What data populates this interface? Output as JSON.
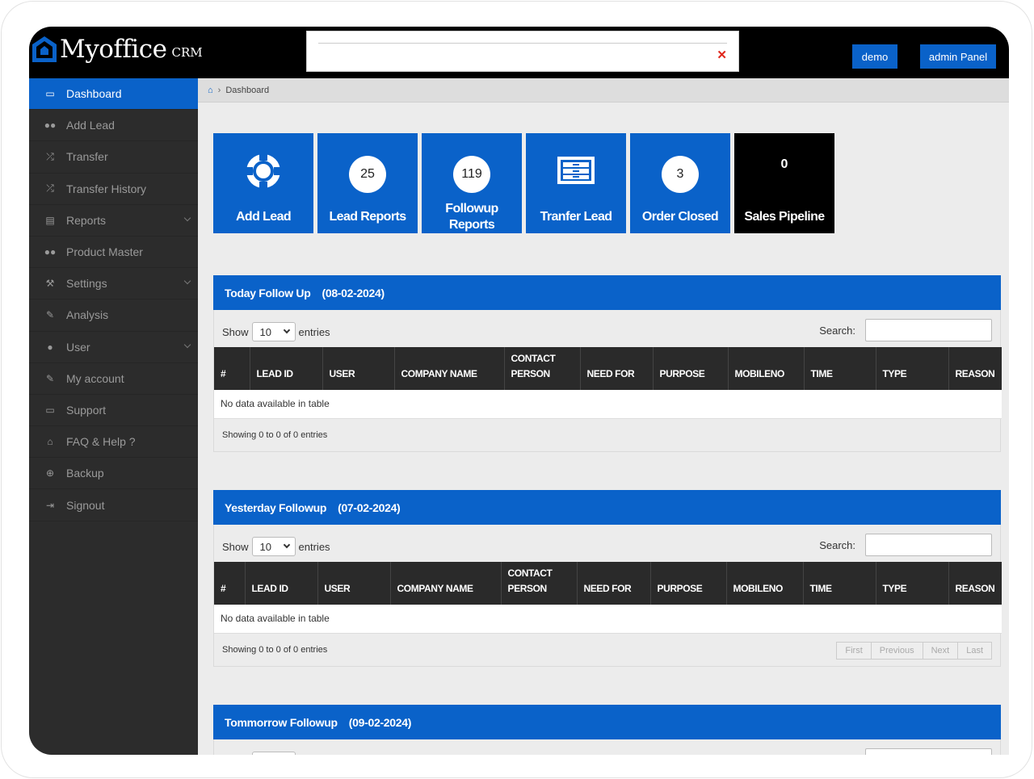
{
  "app": {
    "brand": "Myoffice",
    "brand_suffix": "CRM"
  },
  "search": {
    "clear_icon": "close-icon"
  },
  "top_buttons": {
    "demo": "demo",
    "admin": "admin Panel"
  },
  "sidebar": {
    "items": [
      {
        "label": "Dashboard",
        "icon": "laptop-icon",
        "active": true
      },
      {
        "label": "Add Lead",
        "icon": "users-icon"
      },
      {
        "label": "Transfer",
        "icon": "shuffle-icon"
      },
      {
        "label": "Transfer History",
        "icon": "shuffle-icon"
      },
      {
        "label": "Reports",
        "icon": "book-icon",
        "dropdown": true
      },
      {
        "label": "Product Master",
        "icon": "users-icon"
      },
      {
        "label": "Settings",
        "icon": "wrench-icon",
        "dropdown": true
      },
      {
        "label": "Analysis",
        "icon": "pencil-icon"
      },
      {
        "label": "User",
        "icon": "user-icon",
        "dropdown": true
      },
      {
        "label": "My account",
        "icon": "edit-icon"
      },
      {
        "label": "Support",
        "icon": "laptop-icon"
      },
      {
        "label": "FAQ & Help ?",
        "icon": "home-icon"
      },
      {
        "label": "Backup",
        "icon": "download-icon"
      },
      {
        "label": "Signout",
        "icon": "signout-icon"
      }
    ]
  },
  "breadcrumb": {
    "current": "Dashboard"
  },
  "tiles": [
    {
      "label": "Add Lead",
      "value": null,
      "icon": "lifebuoy-icon"
    },
    {
      "label": "Lead Reports",
      "value": "25"
    },
    {
      "label": "Followup Reports",
      "value": "119"
    },
    {
      "label": "Tranfer Lead",
      "value": null,
      "icon": "cabinet-icon"
    },
    {
      "label": "Order Closed",
      "value": "3"
    },
    {
      "label": "Sales Pipeline",
      "value": "0"
    }
  ],
  "columns": [
    "#",
    "LEAD ID",
    "USER",
    "COMPANY NAME",
    "CONTACT PERSON",
    "NEED FOR",
    "PURPOSE",
    "MOBILENO",
    "TIME",
    "TYPE",
    "REASON"
  ],
  "panels": {
    "today": {
      "title": "Today Follow Up",
      "date": "(08-02-2024)"
    },
    "yesterday": {
      "title": "Yesterday Followup",
      "date": "(07-02-2024)"
    },
    "tomorrow": {
      "title": "Tommorrow Followup",
      "date": "(09-02-2024)"
    }
  },
  "table_ui": {
    "show_label": "Show",
    "entries_value": "10",
    "entries_label": "entries",
    "search_label": "Search:",
    "empty_text": "No data available in table",
    "info_text": "Showing 0 to 0 of 0 entries",
    "pager": {
      "first": "First",
      "previous": "Previous",
      "next": "Next",
      "last": "Last"
    }
  },
  "colors": {
    "accent": "#0a62c9",
    "sidebar": "#2c2c2c",
    "topbar": "#000000"
  }
}
